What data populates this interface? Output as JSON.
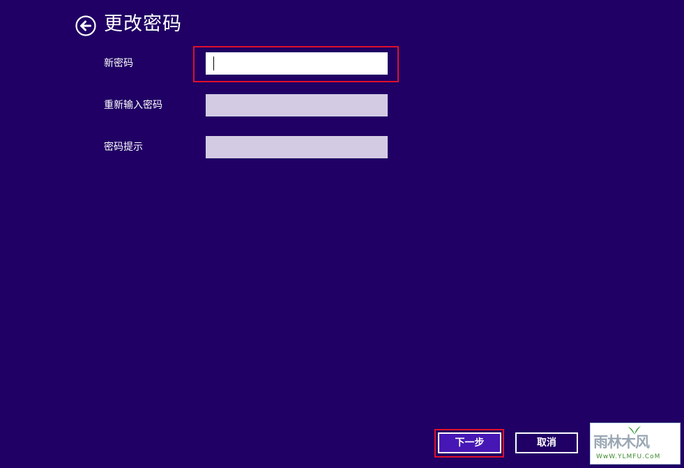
{
  "header": {
    "title": "更改密码",
    "back_icon": "back-arrow-circle-icon"
  },
  "form": {
    "fields": [
      {
        "label": "新密码",
        "value": "",
        "focused": true
      },
      {
        "label": "重新输入密码",
        "value": "",
        "focused": false
      },
      {
        "label": "密码提示",
        "value": "",
        "focused": false
      }
    ]
  },
  "footer": {
    "next_label": "下一步",
    "cancel_label": "取消"
  },
  "watermark": {
    "text": "雨林木风",
    "url": "WwW.YLMFU.CoM"
  },
  "colors": {
    "background": "#200064",
    "active_input": "#ffffff",
    "inactive_input": "#d3cbe4",
    "primary_button": "#4617b4",
    "highlight": "#e0102a"
  }
}
